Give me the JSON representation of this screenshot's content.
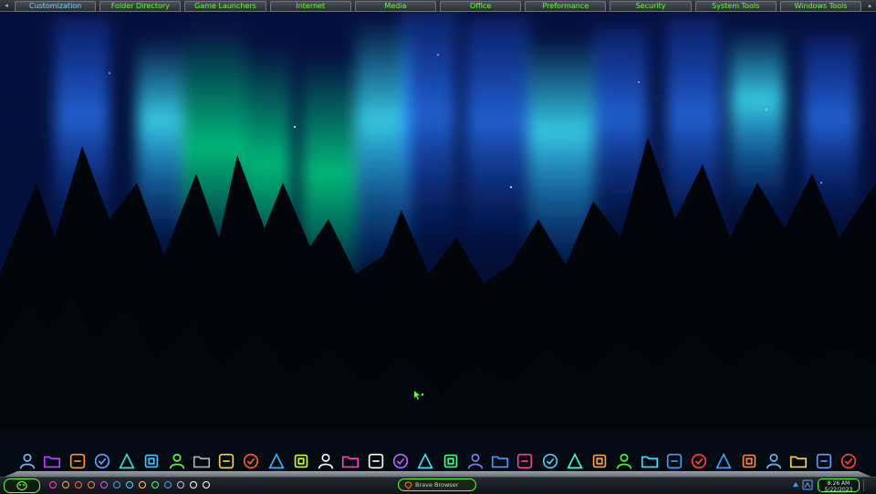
{
  "toolbar": {
    "tabs": [
      {
        "label": "Customization",
        "active": true
      },
      {
        "label": "Folder Directory"
      },
      {
        "label": "Game Launchers"
      },
      {
        "label": "Internet"
      },
      {
        "label": "Media"
      },
      {
        "label": "Office"
      },
      {
        "label": "Preformance"
      },
      {
        "label": "Security"
      },
      {
        "label": "System Tools"
      },
      {
        "label": "Windows Tools"
      }
    ],
    "left_arrow": "◂",
    "right_arrow": "▴"
  },
  "dock": {
    "icons": [
      "user-icon",
      "folder-purple-icon",
      "folder-orange-icon",
      "folder-blue-icon",
      "folder-teal-icon",
      "folder-cyan-icon",
      "folder-green-icon",
      "folder-gray-icon",
      "book-icon",
      "cone-icon",
      "globe-icon",
      "gimp-icon",
      "paw-icon",
      "media-icon",
      "github-icon",
      "k-icon",
      "document-icon",
      "share-icon",
      "video-icon",
      "steam-icon",
      "palette-icon",
      "airplane-icon",
      "monitor-icon",
      "broom-icon",
      "keyboard-icon",
      "screen-icon",
      "download-icon",
      "bolt-icon",
      "aperture-icon",
      "export-icon",
      "info-icon",
      "shield-yellow-icon",
      "defender-icon",
      "shield-red-icon"
    ],
    "colors": [
      "#7ab8ff",
      "#c040ff",
      "#ff9a20",
      "#60a0ff",
      "#40e0d0",
      "#40c8ff",
      "#60ff40",
      "#b0b0b0",
      "#ffd040",
      "#ff6020",
      "#40b0ff",
      "#c0ff40",
      "#ffffff",
      "#ff40c0",
      "#ffffff",
      "#c060ff",
      "#40e0ff",
      "#40ff80",
      "#8080ff",
      "#40a0ff",
      "#ff40a0",
      "#40d0ff",
      "#40ffd0",
      "#ffa040",
      "#40ff40",
      "#40e0ff",
      "#40a0ff",
      "#ff4040",
      "#40a0ff",
      "#ff8040",
      "#60c0ff",
      "#ffd040",
      "#60a0ff",
      "#ff4040"
    ]
  },
  "taskbar": {
    "start_icon": "start-orb-icon",
    "quick_launch": [
      "search-icon",
      "gear-icon",
      "shield-icon",
      "brave-icon",
      "cloud-icon",
      "eye-icon",
      "settings-icon",
      "chat-icon",
      "pulse-icon",
      "ok-icon",
      "clock-icon",
      "monitor-icon",
      "terminal-icon"
    ],
    "task_button": {
      "label": "Brave Browser",
      "icon": "brave-lion-icon"
    },
    "tray": [
      "up-arrow-icon",
      "network-icon"
    ],
    "clock": {
      "time": "8:26 AM",
      "date": "5/22/2023"
    }
  },
  "accent_color": "#66ff33"
}
